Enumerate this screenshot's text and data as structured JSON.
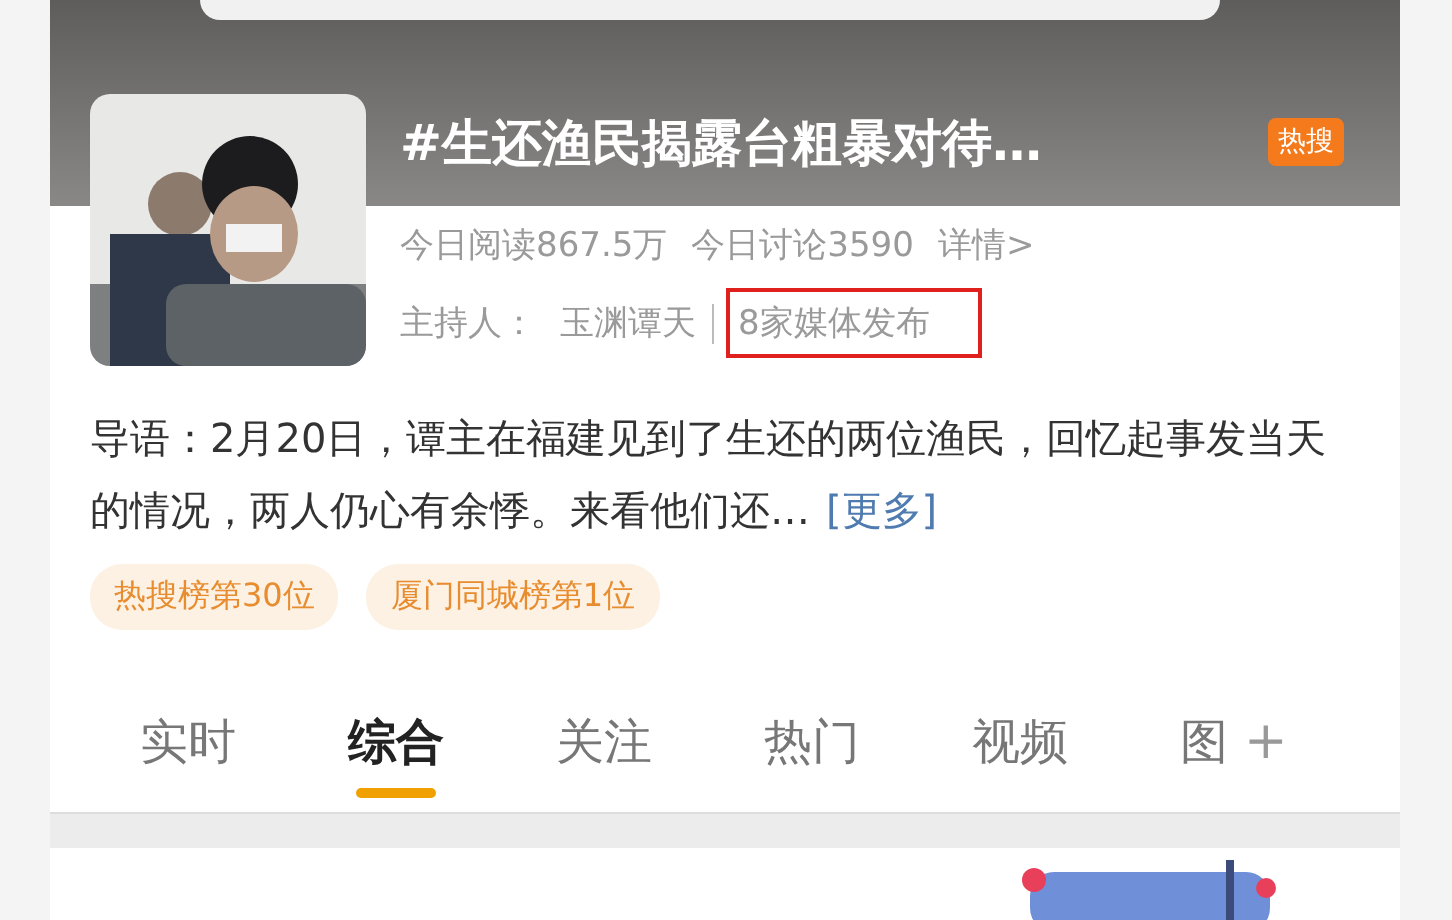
{
  "topic": {
    "title": "#生还渔民揭露台粗暴对待…",
    "badge": "热搜",
    "stats": [
      {
        "text": "今日阅读867.5万"
      },
      {
        "text": "今日讨论3590"
      },
      {
        "text": "详情>"
      }
    ],
    "host_label": "主持人：",
    "host": "玉渊谭天",
    "media": {
      "text": "8家媒体发布",
      "highlighted": true
    }
  },
  "intro": {
    "text": "导语：2月20日，谭主在福建见到了生还的两位渔民，回忆起事发当天的情况，两人仍心有余悸。来看他们还…",
    "more": "[更多]"
  },
  "tags": [
    "热搜榜第30位",
    "厦门同城榜第1位"
  ],
  "tabs": [
    {
      "label": "实时",
      "selected": false
    },
    {
      "label": "综合",
      "selected": true
    },
    {
      "label": "关注",
      "selected": false
    },
    {
      "label": "热门",
      "selected": false
    },
    {
      "label": "视频",
      "selected": false
    },
    {
      "label": "图",
      "selected": false
    }
  ],
  "add_tab": "+"
}
